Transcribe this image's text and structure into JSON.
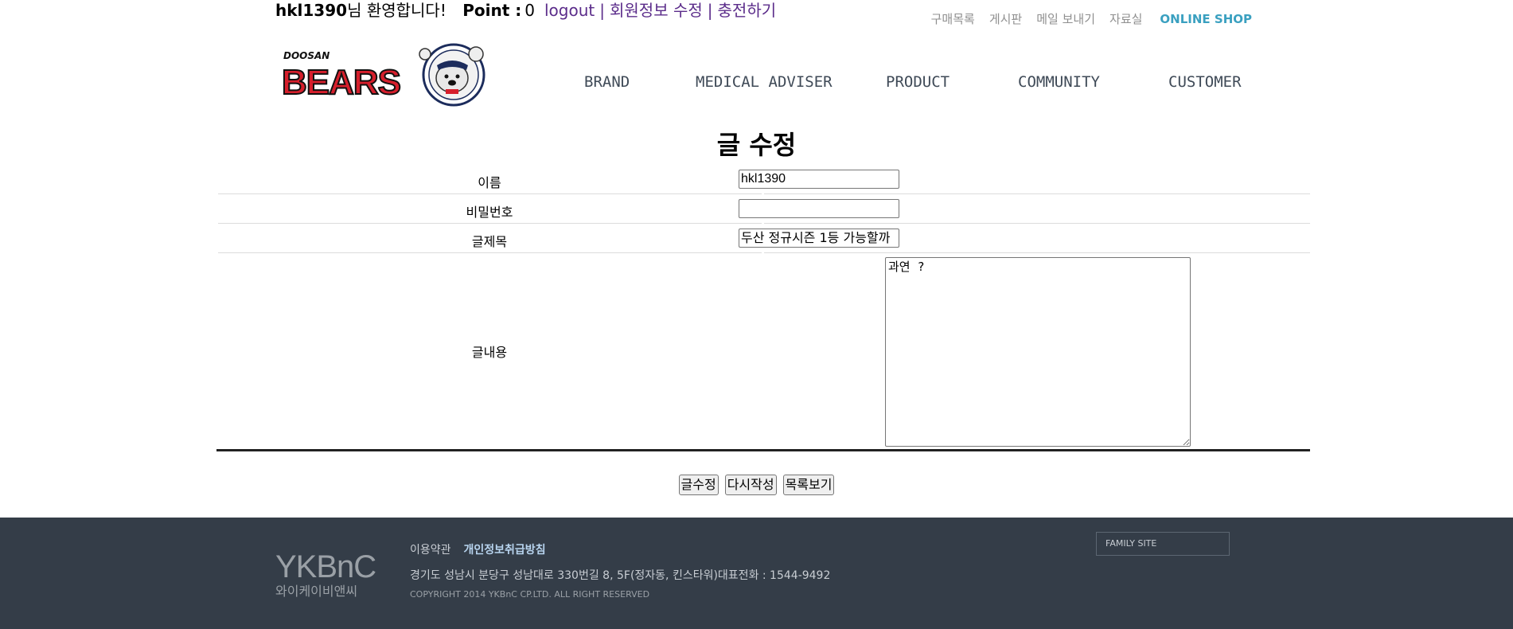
{
  "topbar": {
    "user_id": "hkl1390",
    "welcome_suffix": "님 환영합니다!",
    "point_label": "Point :",
    "point_value": "0",
    "links": {
      "logout": "logout",
      "edit_profile": "회원정보 수정",
      "charge": "충전하기"
    },
    "separator": "|"
  },
  "util_nav": {
    "purchase_list": "구매목록",
    "board": "게시판",
    "send_mail": "메일 보내기",
    "archive": "자료실",
    "online_shop": "ONLINE SHOP"
  },
  "logo": {
    "brand_small": "DOOSAN",
    "brand_large": "BEARS"
  },
  "gnb": [
    "BRAND",
    "MEDICAL ADVISER",
    "PRODUCT",
    "COMMUNITY",
    "CUSTOMER"
  ],
  "form": {
    "title": "글 수정",
    "name_label": "이름",
    "name_value": "hkl1390",
    "password_label": "비밀번호",
    "password_value": "",
    "subject_label": "글제목",
    "subject_value": "두산 정규시즌 1등 가능할까",
    "content_label": "글내용",
    "content_value": "과연 ?"
  },
  "buttons": {
    "submit": "글수정",
    "reset": "다시작성",
    "list": "목록보기"
  },
  "footer": {
    "logo_text": "YKBnC",
    "logo_korean": "와이케이비앤씨",
    "terms": "이용약관",
    "privacy": "개인정보취급방침",
    "address": "경기도 성남시 분당구 성남대로 330번길 8, 5F(정자동, 킨스타워)대표전화 : 1544-9492",
    "copyright": "COPYRIGHT 2014 YKBnC CP.LTD. ALL RIGHT RESERVED",
    "family_site": "FAMILY SITE"
  },
  "colors": {
    "accent_link": "#5b2c8a",
    "online_shop": "#3aa0c0",
    "footer_bg": "#343d48",
    "nav_text": "#3f4a57"
  }
}
